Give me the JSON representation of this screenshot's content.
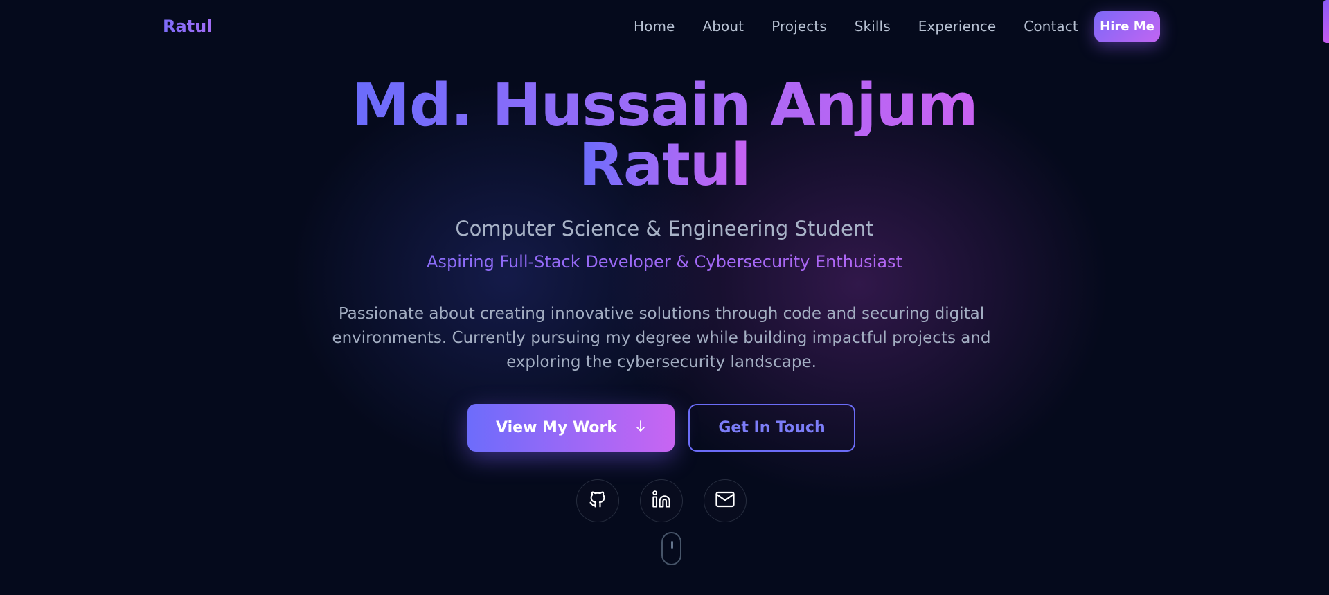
{
  "brand": "Ratul",
  "nav": {
    "links": [
      "Home",
      "About",
      "Projects",
      "Skills",
      "Experience",
      "Contact"
    ],
    "cta": "Hire Me"
  },
  "hero": {
    "name_line1": "Md. Hussain Anjum",
    "name_line2": "Ratul",
    "subtitle": "Computer Science & Engineering Student",
    "tagline": "Aspiring Full-Stack Developer & Cybersecurity Enthusiast",
    "description": "Passionate about creating innovative solutions through code and securing digital environments. Currently pursuing my degree while building impactful projects and exploring the cybersecurity landscape.",
    "primary_button": "View My Work",
    "primary_button_icon": "arrow-down-icon",
    "secondary_button": "Get In Touch"
  },
  "social": [
    {
      "icon": "github-icon"
    },
    {
      "icon": "linkedin-icon"
    },
    {
      "icon": "mail-icon"
    }
  ],
  "colors": {
    "background": "#050a1c",
    "gradient_start": "#6a6cfb",
    "gradient_end": "#c962f2",
    "outline_accent": "#6b6cf6"
  }
}
